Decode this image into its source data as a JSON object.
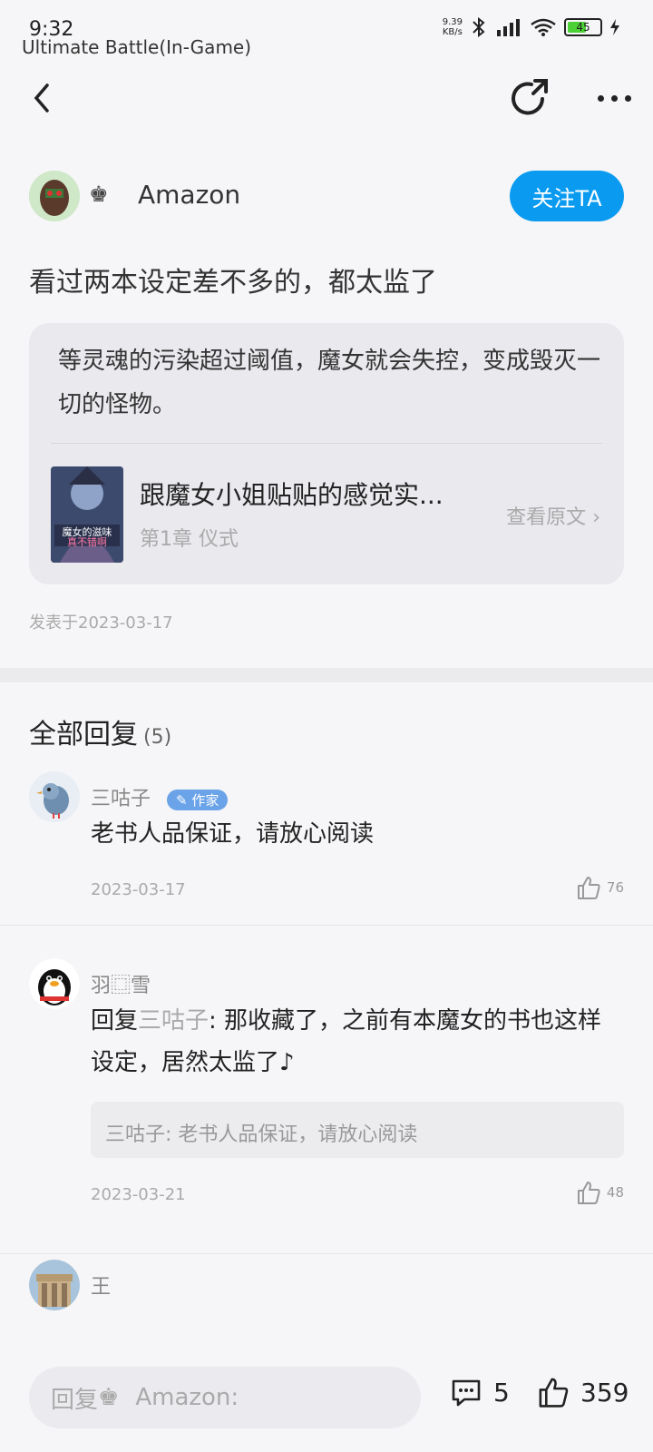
{
  "status_bar": {
    "time": "9:32",
    "app_label": "Ultimate Battle(In-Game)",
    "speed_value": "9.39",
    "speed_unit": "KB/s",
    "battery": "45"
  },
  "author": {
    "name": "Amazon",
    "follow_label": "关注TA"
  },
  "post": {
    "text": "看过两本设定差不多的，都太监了",
    "quote": "等灵魂的污染超过阈值，魔女就会失控，变成毁灭一切的怪物。",
    "book_title": "跟魔女小姐贴贴的感觉实...",
    "chapter": "第1章 仪式",
    "view_original": "查看原文",
    "date": "发表于2023-03-17"
  },
  "replies": {
    "header": "全部回复",
    "count": "(5)",
    "items": [
      {
        "name": "三咕子",
        "badge": "作家",
        "text": "老书人品保证，请放心阅读",
        "date": "2023-03-17",
        "likes": "76"
      },
      {
        "name": "羽​⿴雪",
        "reply_prefix": "回复",
        "mention": "三咕子",
        "text": ": 那收藏了，之前有本魔女的书也这样设定，居然太监了♪",
        "quoted": "三咕子: 老书人品保证，请放心阅读",
        "date": "2023-03-21",
        "likes": "48"
      },
      {
        "name": "王"
      }
    ]
  },
  "bottom_bar": {
    "reply_prefix": "回复",
    "reply_name": "Amazon:",
    "comment_count": "5",
    "like_count": "359"
  }
}
